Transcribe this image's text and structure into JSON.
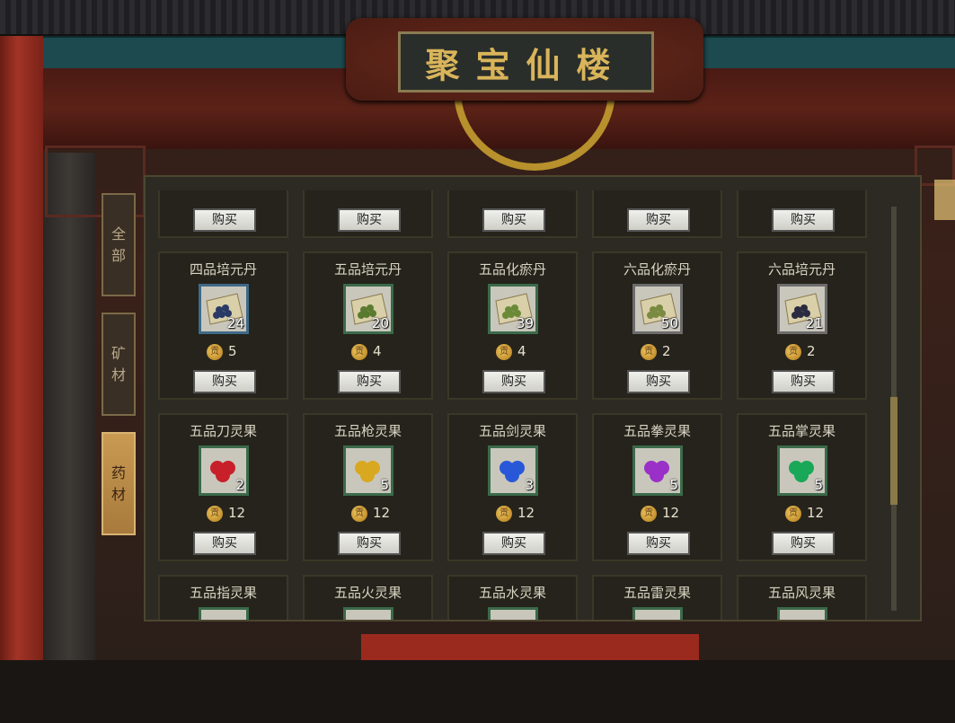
{
  "header": {
    "title": "聚宝仙楼"
  },
  "sidebar": {
    "tabs": [
      {
        "label": "全部",
        "active": false
      },
      {
        "label": "矿材",
        "active": false
      },
      {
        "label": "药材",
        "active": true
      }
    ]
  },
  "shop": {
    "buy_label": "购买",
    "currency_symbol": "贡",
    "rows": [
      {
        "items": [
          {
            "name": "",
            "qty": "",
            "price": "",
            "icon": "pill-packet-icon"
          },
          {
            "name": "",
            "qty": "",
            "price": "",
            "icon": "pill-packet-icon"
          },
          {
            "name": "",
            "qty": "",
            "price": "",
            "icon": "pill-packet-icon"
          },
          {
            "name": "",
            "qty": "",
            "price": "",
            "icon": "pill-packet-icon"
          },
          {
            "name": "",
            "qty": "",
            "price": "",
            "icon": "pill-packet-icon"
          }
        ]
      },
      {
        "items": [
          {
            "name": "四品培元丹",
            "qty": "24",
            "price": "5",
            "quality": "q4",
            "pill": "#2a3a66",
            "icon": "pill-packet-icon"
          },
          {
            "name": "五品培元丹",
            "qty": "20",
            "price": "4",
            "quality": "q5",
            "pill": "#5a7a30",
            "icon": "pill-packet-icon"
          },
          {
            "name": "五品化瘀丹",
            "qty": "39",
            "price": "4",
            "quality": "q5",
            "pill": "#6a8a38",
            "icon": "pill-packet-icon"
          },
          {
            "name": "六品化瘀丹",
            "qty": "50",
            "price": "2",
            "quality": "q6",
            "pill": "#7a8a40",
            "icon": "pill-packet-icon"
          },
          {
            "name": "六品培元丹",
            "qty": "21",
            "price": "2",
            "quality": "q6",
            "pill": "#2a2a40",
            "icon": "pill-packet-icon"
          }
        ]
      },
      {
        "items": [
          {
            "name": "五品刀灵果",
            "qty": "2",
            "price": "12",
            "quality": "q5",
            "fruit": "#c8202a",
            "icon": "spirit-fruit-icon"
          },
          {
            "name": "五品枪灵果",
            "qty": "5",
            "price": "12",
            "quality": "q5",
            "fruit": "#d8a820",
            "icon": "spirit-fruit-icon"
          },
          {
            "name": "五品剑灵果",
            "qty": "3",
            "price": "12",
            "quality": "q5",
            "fruit": "#2858d8",
            "icon": "spirit-fruit-icon"
          },
          {
            "name": "五品拳灵果",
            "qty": "5",
            "price": "12",
            "quality": "q5",
            "fruit": "#9a30c8",
            "icon": "spirit-fruit-icon"
          },
          {
            "name": "五品掌灵果",
            "qty": "5",
            "price": "12",
            "quality": "q5",
            "fruit": "#18a858",
            "icon": "spirit-fruit-icon"
          }
        ]
      },
      {
        "items": [
          {
            "name": "五品指灵果",
            "qty": "",
            "price": "",
            "quality": "q5",
            "icon": "spirit-fruit-icon"
          },
          {
            "name": "五品火灵果",
            "qty": "",
            "price": "",
            "quality": "q5",
            "icon": "spirit-fruit-icon"
          },
          {
            "name": "五品水灵果",
            "qty": "",
            "price": "",
            "quality": "q5",
            "icon": "spirit-fruit-icon"
          },
          {
            "name": "五品雷灵果",
            "qty": "",
            "price": "",
            "quality": "q5",
            "icon": "spirit-fruit-icon"
          },
          {
            "name": "五品风灵果",
            "qty": "",
            "price": "",
            "quality": "q5",
            "icon": "spirit-fruit-icon"
          }
        ]
      }
    ]
  }
}
